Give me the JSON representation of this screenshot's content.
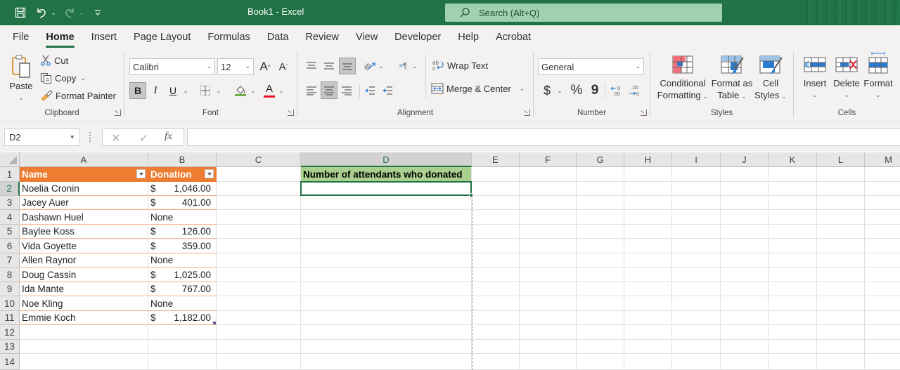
{
  "titlebar": {
    "title": "Book1  -  Excel",
    "search_placeholder": "Search (Alt+Q)",
    "qat": [
      "save-icon",
      "undo-icon",
      "redo-icon",
      "customize-qat-icon"
    ]
  },
  "tabs": [
    {
      "label": "File",
      "active": false
    },
    {
      "label": "Home",
      "active": true
    },
    {
      "label": "Insert",
      "active": false
    },
    {
      "label": "Page Layout",
      "active": false
    },
    {
      "label": "Formulas",
      "active": false
    },
    {
      "label": "Data",
      "active": false
    },
    {
      "label": "Review",
      "active": false
    },
    {
      "label": "View",
      "active": false
    },
    {
      "label": "Developer",
      "active": false
    },
    {
      "label": "Help",
      "active": false
    },
    {
      "label": "Acrobat",
      "active": false
    }
  ],
  "ribbon": {
    "clipboard": {
      "label": "Clipboard",
      "paste": "Paste",
      "cut": "Cut",
      "copy": "Copy",
      "format_painter": "Format Painter"
    },
    "font": {
      "label": "Font",
      "font_name": "Calibri",
      "font_size": "12",
      "grow": "A",
      "shrink": "A",
      "bold": "B",
      "italic": "I",
      "underline": "U",
      "font_color_letter": "A",
      "fill_color": "#70ad47",
      "font_color": "#e81123"
    },
    "alignment": {
      "label": "Alignment",
      "wrap_text": "Wrap Text",
      "merge_center": "Merge & Center"
    },
    "number": {
      "label": "Number",
      "format": "General",
      "currency": "$",
      "percent": "%",
      "comma": "9"
    },
    "styles": {
      "label": "Styles",
      "conditional_formatting": [
        "Conditional",
        "Formatting"
      ],
      "format_as_table": [
        "Format as",
        "Table"
      ],
      "cell_styles": [
        "Cell",
        "Styles"
      ]
    },
    "cells": {
      "label": "Cells",
      "insert": "Insert",
      "delete": "Delete",
      "format": "Format"
    }
  },
  "formula_bar": {
    "name_box": "D2",
    "fx": "fx",
    "formula": ""
  },
  "sheet": {
    "columns": [
      "A",
      "B",
      "C",
      "D",
      "E",
      "F",
      "G",
      "H",
      "I",
      "J",
      "K",
      "L",
      "M"
    ],
    "selected_column": "D",
    "selected_row": "2",
    "rows": [
      "1",
      "2",
      "3",
      "4",
      "5",
      "6",
      "7",
      "8",
      "9",
      "10",
      "11",
      "12",
      "13",
      "14"
    ],
    "table_headers": [
      "Name",
      "Donation"
    ],
    "table_rows": [
      {
        "name": "Noelia Cronin",
        "currency": "$",
        "amount": "1,046.00"
      },
      {
        "name": "Jacey Auer",
        "currency": "$",
        "amount": "401.00"
      },
      {
        "name": "Dashawn Huel",
        "currency": "",
        "amount": "None"
      },
      {
        "name": "Baylee Koss",
        "currency": "$",
        "amount": "126.00"
      },
      {
        "name": "Vida Goyette",
        "currency": "$",
        "amount": "359.00"
      },
      {
        "name": "Allen Raynor",
        "currency": "",
        "amount": "None"
      },
      {
        "name": "Doug Cassin",
        "currency": "$",
        "amount": "1,025.00"
      },
      {
        "name": "Ida Mante",
        "currency": "$",
        "amount": "767.00"
      },
      {
        "name": "Noe Kling",
        "currency": "",
        "amount": "None"
      },
      {
        "name": "Emmie Koch",
        "currency": "$",
        "amount": "1,182.00"
      }
    ],
    "d1": "Number of attendants who donated",
    "d2": "",
    "header_color": "#ed7d31",
    "d1_color": "#a9d08e",
    "accent": "#217346"
  }
}
